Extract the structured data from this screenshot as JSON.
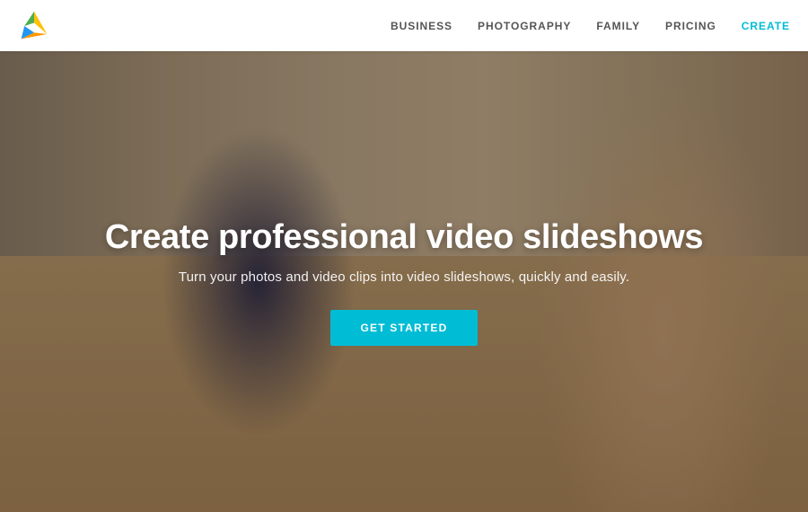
{
  "navbar": {
    "links": [
      {
        "id": "business",
        "label": "BUSINESS",
        "active": false
      },
      {
        "id": "photography",
        "label": "PHOTOGRAPHY",
        "active": false
      },
      {
        "id": "family",
        "label": "FAMILY",
        "active": false
      },
      {
        "id": "pricing",
        "label": "PRICING",
        "active": false
      },
      {
        "id": "create",
        "label": "CREATE",
        "active": true
      }
    ]
  },
  "hero": {
    "title": "Create professional video slideshows",
    "subtitle": "Turn your photos and video clips into video slideshows, quickly and easily.",
    "cta_label": "GET STARTED"
  },
  "colors": {
    "accent": "#00bcd4",
    "nav_active": "#00bcd4",
    "text_light": "#ffffff"
  }
}
